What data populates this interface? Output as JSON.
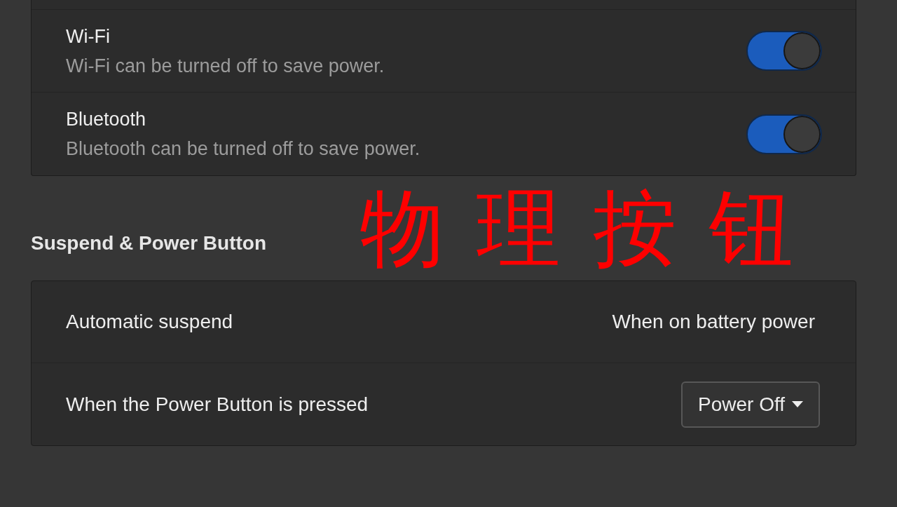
{
  "power_saving_rows": [
    {
      "title": "Wi-Fi",
      "subtitle": "Wi-Fi can be turned off to save power.",
      "on": true
    },
    {
      "title": "Bluetooth",
      "subtitle": "Bluetooth can be turned off to save power.",
      "on": true
    }
  ],
  "suspend_section": {
    "heading": "Suspend & Power Button",
    "rows": [
      {
        "kind": "value",
        "label": "Automatic suspend",
        "value": "When on battery power"
      },
      {
        "kind": "dropdown",
        "label": "When the Power Button is pressed",
        "value": "Power Off"
      }
    ]
  },
  "annotation": {
    "text": "物 理 按 钮"
  }
}
